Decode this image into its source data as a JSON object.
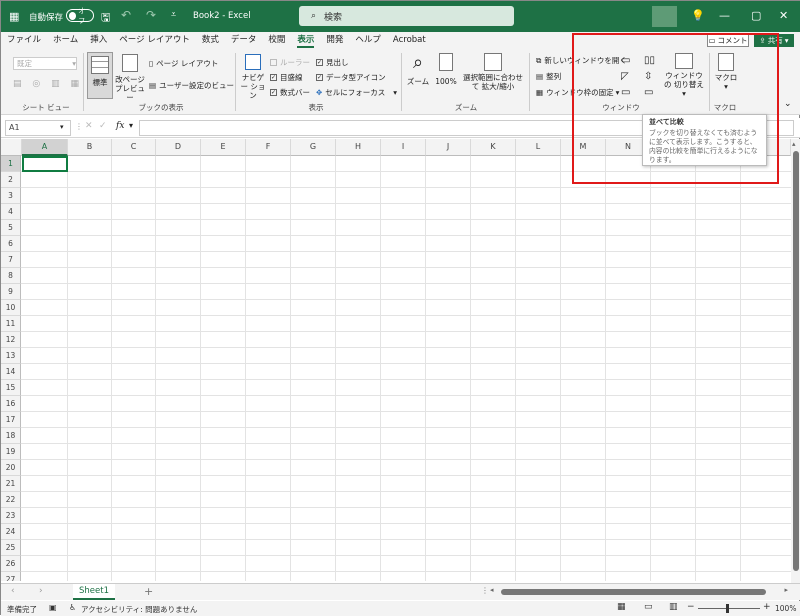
{
  "titlebar": {
    "autosave_label": "自動保存",
    "autosave_state": "オフ",
    "file_title": "Book2 - Excel",
    "search_placeholder": "検索"
  },
  "menu": [
    "ファイル",
    "ホーム",
    "挿入",
    "ページ レイアウト",
    "数式",
    "データ",
    "校閲",
    "表示",
    "開発",
    "ヘルプ",
    "Acrobat"
  ],
  "active_tab": "表示",
  "header_buttons": {
    "comment": "コメント",
    "share": "共有"
  },
  "ribbon": {
    "sheetview": {
      "dropdown": "既定",
      "label": "シート ビュー"
    },
    "bookview": {
      "normal": "標準",
      "pagebreak": "改ページ プレビュー",
      "pagelayout": "ページ レイアウト",
      "custom": "ユーザー設定のビュー",
      "label": "ブックの表示"
    },
    "show": {
      "navigator": "ナビゲー ション",
      "ruler": "ルーラー",
      "gridlines": "目盛線",
      "formulabar": "数式バー",
      "headings": "見出し",
      "datatype": "データ型アイコン",
      "focus": "セルにフォーカス",
      "label": "表示"
    },
    "zoom": {
      "zoom": "ズーム",
      "pct": "100%",
      "fit": "選択範囲に合わせて 拡大/縮小",
      "label": "ズーム"
    },
    "window": {
      "newwin": "新しいウィンドウを開く",
      "arrange": "整列",
      "freeze": "ウィンドウ枠の固定",
      "switch": "ウィンドウの 切り替え",
      "label": "ウィンドウ"
    },
    "macro": {
      "btn": "マクロ",
      "label": "マクロ"
    }
  },
  "tooltip": {
    "title": "並べて比較",
    "desc": "ブックを切り替えなくても済むように並べて表示します。こうすると、内容の比較を簡単に行えるようになります。"
  },
  "formula": {
    "namebox": "A1",
    "fx": "fx"
  },
  "columns": [
    "A",
    "B",
    "C",
    "D",
    "E",
    "F",
    "G",
    "H",
    "I",
    "J",
    "K",
    "L",
    "M",
    "N",
    "O"
  ],
  "rows": [
    "1",
    "2",
    "3",
    "4",
    "5",
    "6",
    "7",
    "8",
    "9",
    "10",
    "11",
    "12",
    "13",
    "14",
    "15",
    "16",
    "17",
    "18",
    "19",
    "20",
    "21",
    "22",
    "23",
    "24",
    "25",
    "26",
    "27"
  ],
  "sheet_tab": "Sheet1",
  "status": {
    "ready": "準備完了",
    "accessibility": "アクセシビリティ: 問題ありません",
    "zoom": "100%"
  }
}
